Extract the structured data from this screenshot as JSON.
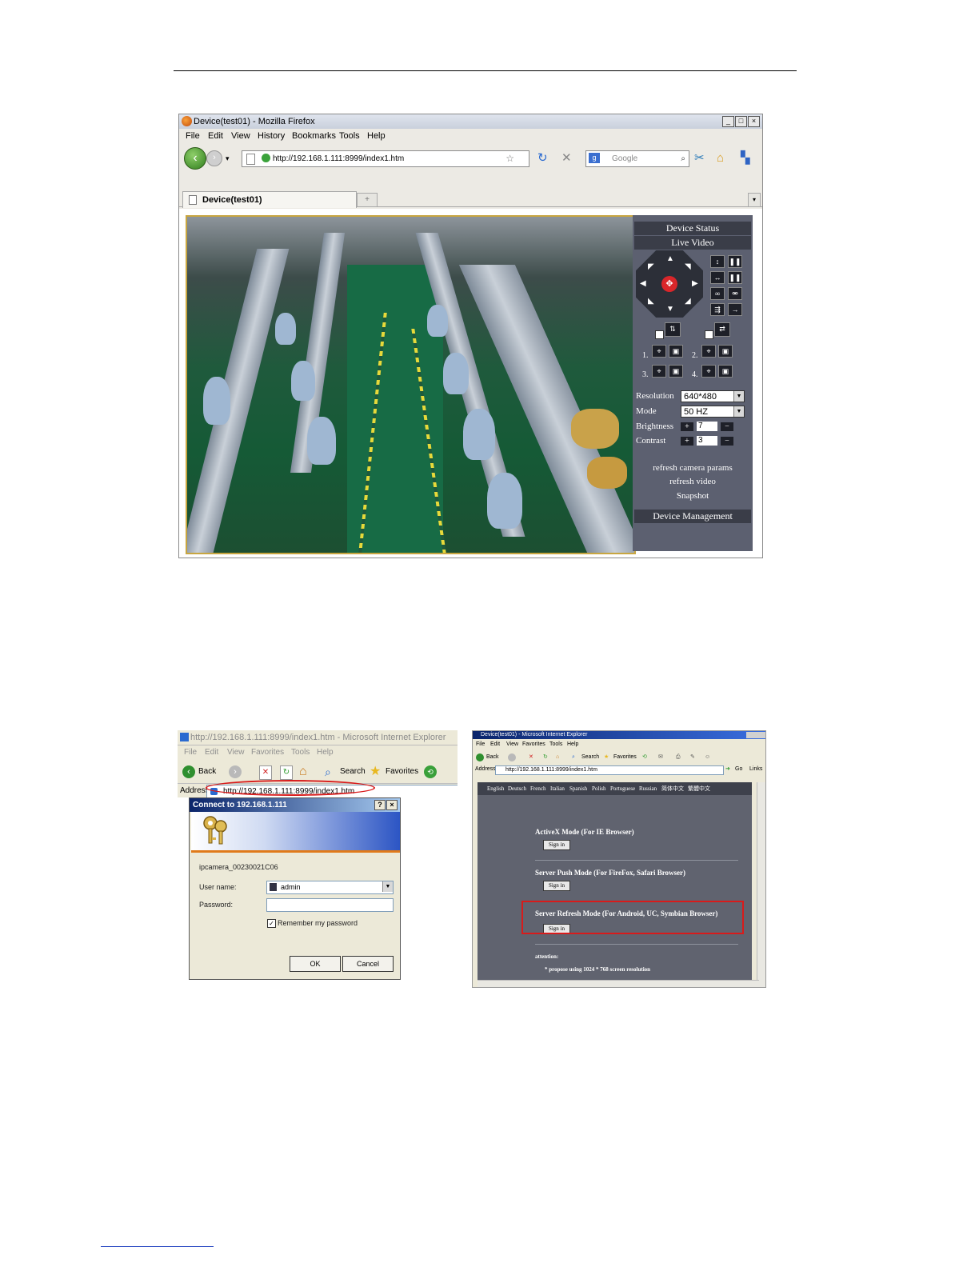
{
  "firefox": {
    "window_title": "Device(test01) - Mozilla Firefox",
    "menu": [
      "File",
      "Edit",
      "View",
      "History",
      "Bookmarks",
      "Tools",
      "Help"
    ],
    "url": "http://192.168.1.111:8999/index1.htm",
    "search_placeholder": "Google",
    "tab_title": "Device(test01)",
    "panel": {
      "device_status": "Device Status",
      "live_video": "Live Video",
      "preset_numbers": [
        "1.",
        "2.",
        "3.",
        "4."
      ],
      "resolution_label": "Resolution",
      "resolution_value": "640*480",
      "mode_label": "Mode",
      "mode_value": "50 HZ",
      "brightness_label": "Brightness",
      "brightness_value": "7",
      "contrast_label": "Contrast",
      "contrast_value": "3",
      "refresh_params": "refresh camera params",
      "refresh_video": "refresh video",
      "snapshot": "Snapshot",
      "device_management": "Device Management"
    }
  },
  "ie_login": {
    "window_title": "http://192.168.1.111:8999/index1.htm - Microsoft Internet Explorer",
    "menu": [
      "File",
      "Edit",
      "View",
      "Favorites",
      "Tools",
      "Help"
    ],
    "back_label": "Back",
    "search_label": "Search",
    "favorites_label": "Favorites",
    "address_label": "Address",
    "address_value": "http://192.168.1.111:8999/index1.htm",
    "dialog": {
      "title": "Connect to 192.168.1.111",
      "realm": "ipcamera_00230021C06",
      "username_label": "User name:",
      "username_value": "admin",
      "password_label": "Password:",
      "remember_label": "Remember my password",
      "ok": "OK",
      "cancel": "Cancel"
    }
  },
  "ie_modes": {
    "window_title": "Device(test01) - Microsoft Internet Explorer",
    "menu": [
      "File",
      "Edit",
      "View",
      "Favorites",
      "Tools",
      "Help"
    ],
    "back_label": "Back",
    "search_label": "Search",
    "favorites_label": "Favorites",
    "address_label": "Address",
    "address_value": "http://192.168.1.111:8999/index1.htm",
    "go_label": "Go",
    "links_label": "Links",
    "languages": [
      "English",
      "Deutsch",
      "French",
      "Italian",
      "Spanish",
      "Polish",
      "Portuguese",
      "Russian",
      "简体中文",
      "繁體中文"
    ],
    "modes": [
      {
        "title": "ActiveX Mode (For IE Browser)",
        "button": "Sign in"
      },
      {
        "title": "Server Push Mode (For FireFox, Safari Browser)",
        "button": "Sign in"
      },
      {
        "title": "Server Refresh Mode (For Android, UC, Symbian Browser)",
        "button": "Sign in"
      }
    ],
    "attention_label": "attention:",
    "attention_text": "* propose using 1024 * 768 screen resolution"
  }
}
